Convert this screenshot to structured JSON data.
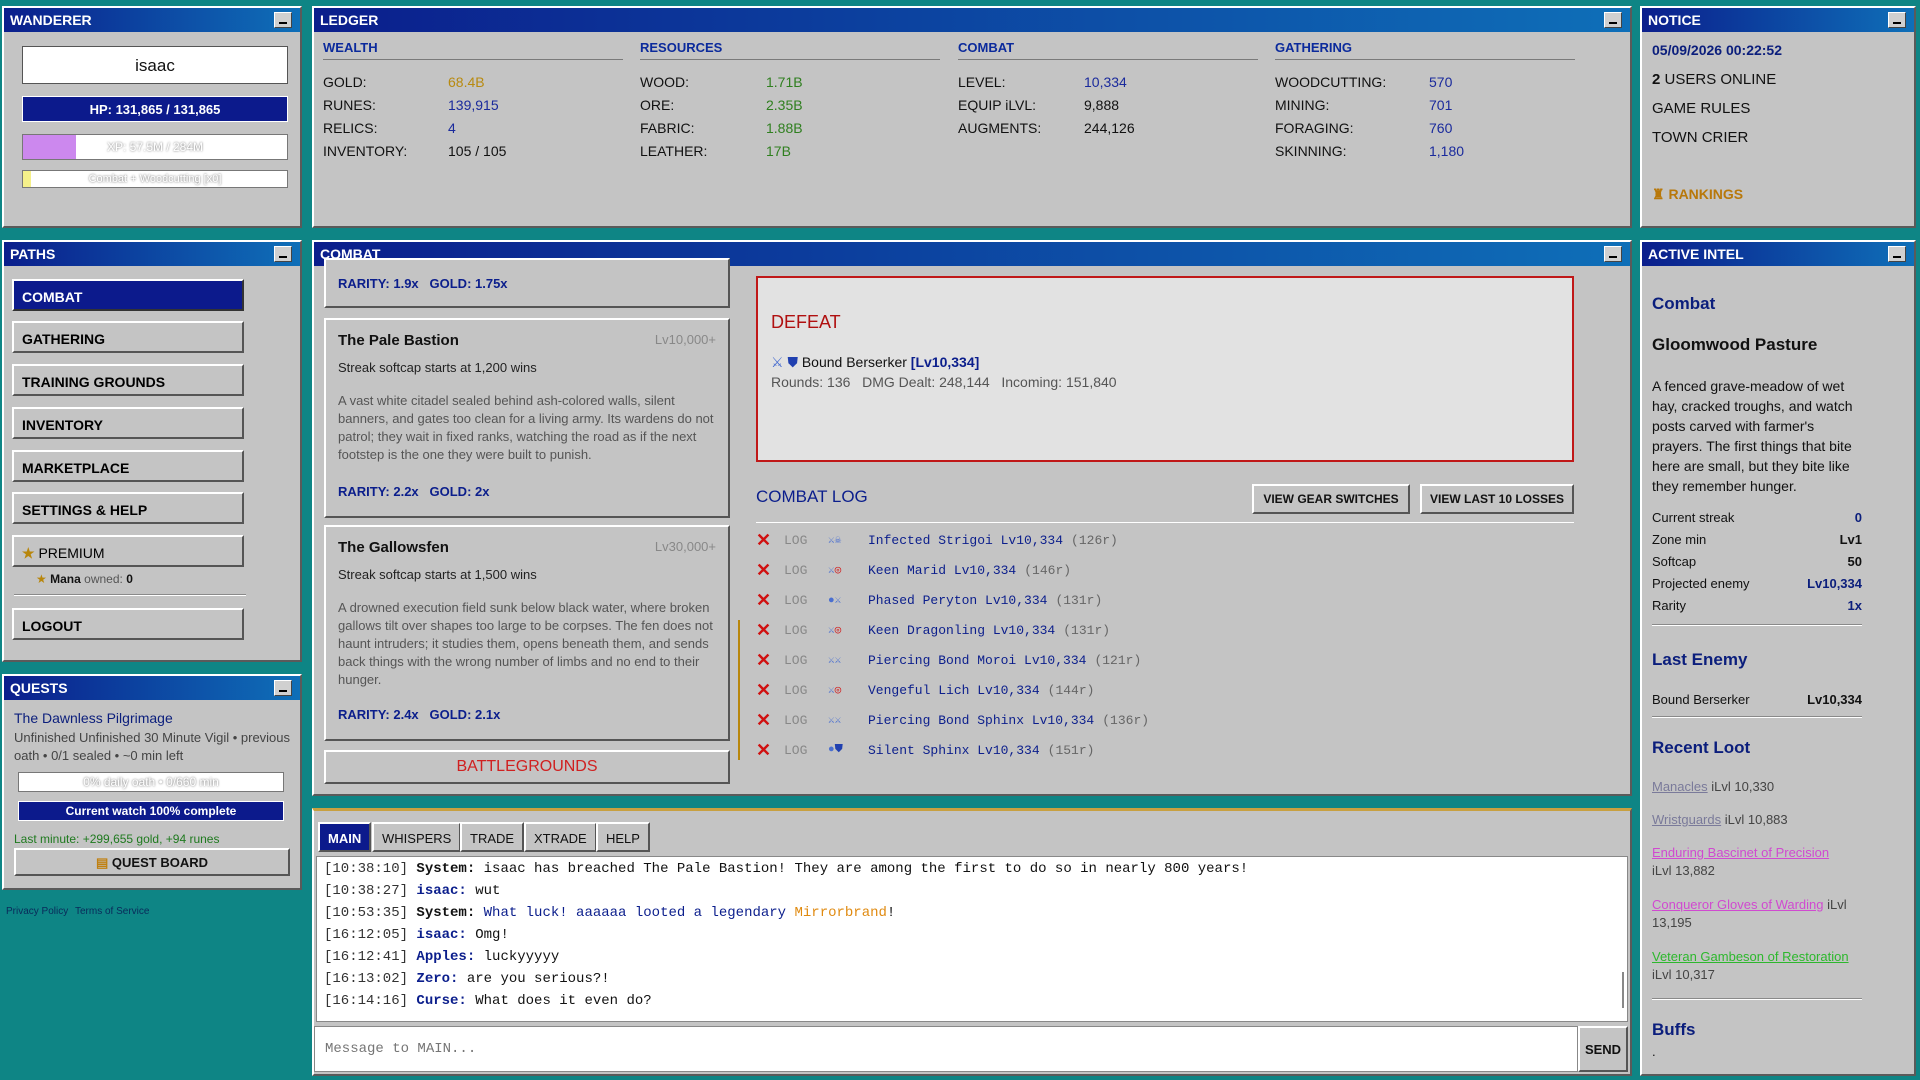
{
  "wanderer": {
    "title": "WANDERER",
    "name": "isaac",
    "hp": "HP: 131,865 / 131,865",
    "xp": "XP: 57.5M / 284M",
    "xp_fraction": 0.2,
    "activity": "Combat + Woodcutting [x0]",
    "activity_fraction": 0.03
  },
  "ledger": {
    "title": "LEDGER",
    "wealth": {
      "head": "WEALTH",
      "rows": [
        {
          "k": "GOLD:",
          "v": "68.4B"
        },
        {
          "k": "RUNES:",
          "v": "139,915"
        },
        {
          "k": "RELICS:",
          "v": "4"
        },
        {
          "k": "INVENTORY:",
          "v": "105 / 105"
        }
      ]
    },
    "resources": {
      "head": "RESOURCES",
      "rows": [
        {
          "k": "WOOD:",
          "v": "1.71B"
        },
        {
          "k": "ORE:",
          "v": "2.35B"
        },
        {
          "k": "FABRIC:",
          "v": "1.88B"
        },
        {
          "k": "LEATHER:",
          "v": "17B"
        }
      ]
    },
    "combat": {
      "head": "COMBAT",
      "rows": [
        {
          "k": "LEVEL:",
          "v": "10,334"
        },
        {
          "k": "EQUIP iLVL:",
          "v": "9,888"
        },
        {
          "k": "AUGMENTS:",
          "v": "244,126"
        }
      ]
    },
    "gathering": {
      "head": "GATHERING",
      "rows": [
        {
          "k": "WOODCUTTING:",
          "v": "570"
        },
        {
          "k": "MINING:",
          "v": "701"
        },
        {
          "k": "FORAGING:",
          "v": "760"
        },
        {
          "k": "SKINNING:",
          "v": "1,180"
        }
      ]
    }
  },
  "notice": {
    "title": "NOTICE",
    "datetime": "05/09/2026 00:22:52",
    "users_count": "2",
    "users_label": "USERS ONLINE",
    "rules": "GAME RULES",
    "crier": "TOWN CRIER",
    "rankings": "RANKINGS"
  },
  "paths": {
    "title": "PATHS",
    "items": [
      "COMBAT",
      "GATHERING",
      "TRAINING GROUNDS",
      "INVENTORY",
      "MARKETPLACE",
      "SETTINGS & HELP"
    ],
    "premium": "PREMIUM",
    "mana_label": "Mana",
    "mana_owned": "owned:",
    "mana_value": "0",
    "logout": "LOGOUT"
  },
  "quests": {
    "title": "QUESTS",
    "name": "The Dawnless Pilgrimage",
    "desc": "Unfinished Unfinished 30 Minute Vigil • previous oath • 0/1 sealed • ~0 min left",
    "daily": "0% daily oath • 0/660 min",
    "watch": "Current watch 100% complete",
    "last_minute": "Last minute: +299,655 gold, +94 runes",
    "board": "QUEST BOARD"
  },
  "footer": {
    "privacy": "Privacy Policy",
    "terms": "Terms of Service"
  },
  "combat": {
    "title": "COMBAT",
    "top_card": {
      "rarity": "RARITY: 1.9x",
      "gold": "GOLD: 1.75x"
    },
    "zones": [
      {
        "name": "The Pale Bastion",
        "level": "Lv10,000+",
        "streak": "Streak softcap starts at 1,200 wins",
        "desc": "A vast white citadel sealed behind ash-colored walls, silent banners, and gates too clean for a living army. Its wardens do not patrol; they wait in fixed ranks, watching the road as if the next footstep is the one they were built to punish.",
        "rarity": "RARITY: 2.2x",
        "gold": "GOLD: 2x"
      },
      {
        "name": "The Gallowsfen",
        "level": "Lv30,000+",
        "streak": "Streak softcap starts at 1,500 wins",
        "desc": "A drowned execution field sunk below black water, where broken gallows tilt over shapes too large to be corpses. The fen does not haunt intruders; it studies them, opens beneath them, and sends back things with the wrong number of limbs and no end to their hunger.",
        "rarity": "RARITY: 2.4x",
        "gold": "GOLD: 2.1x"
      }
    ],
    "battlegrounds": "BATTLEGROUNDS",
    "result": {
      "status": "DEFEAT",
      "enemy": "Bound Berserker",
      "enemy_level": "[Lv10,334]",
      "rounds_label": "Rounds:",
      "rounds": "136",
      "dmg_label": "DMG Dealt:",
      "dmg": "248,144",
      "incoming_label": "Incoming:",
      "incoming": "151,840"
    },
    "log_title": "COMBAT LOG",
    "btn_gear": "VIEW GEAR SWITCHES",
    "btn_losses": "VIEW LAST 10 LOSSES",
    "log": [
      {
        "tag": "LOG",
        "enemy": "Infected Strigoi Lv10,334",
        "rounds": "(126r)"
      },
      {
        "tag": "LOG",
        "enemy": "Keen Marid Lv10,334",
        "rounds": "(146r)"
      },
      {
        "tag": "LOG",
        "enemy": "Phased Peryton Lv10,334",
        "rounds": "(131r)"
      },
      {
        "tag": "LOG",
        "enemy": "Keen Dragonling Lv10,334",
        "rounds": "(131r)"
      },
      {
        "tag": "LOG",
        "enemy": "Piercing Bond Moroi Lv10,334",
        "rounds": "(121r)"
      },
      {
        "tag": "LOG",
        "enemy": "Vengeful Lich Lv10,334",
        "rounds": "(144r)"
      },
      {
        "tag": "LOG",
        "enemy": "Piercing Bond Sphinx Lv10,334",
        "rounds": "(136r)"
      },
      {
        "tag": "LOG",
        "enemy": "Silent Sphinx Lv10,334",
        "rounds": "(151r)"
      }
    ]
  },
  "intel": {
    "title": "ACTIVE INTEL",
    "section": "Combat",
    "zone": "Gloomwood Pasture",
    "desc": "A fenced grave-meadow of wet hay, cracked troughs, and watch posts carved with farmer's prayers. The first things that bite here are small, but they bite like they remember hunger.",
    "stats": [
      {
        "k": "Current streak",
        "v": "0"
      },
      {
        "k": "Zone min",
        "v": "Lv1"
      },
      {
        "k": "Softcap",
        "v": "50"
      },
      {
        "k": "Projected enemy",
        "v": "Lv10,334"
      },
      {
        "k": "Rarity",
        "v": "1x"
      }
    ],
    "last_enemy_head": "Last Enemy",
    "last_enemy": "Bound Berserker",
    "last_enemy_level": "Lv10,334",
    "loot_head": "Recent Loot",
    "loot": [
      {
        "name": "Manacles",
        "ilvl": "iLvl 10,330",
        "color": "#7a7a9a"
      },
      {
        "name": "Wristguards",
        "ilvl": "iLvl 10,883",
        "color": "#7a7a9a"
      },
      {
        "name": "Enduring Bascinet of Precision",
        "ilvl": "iLvl 13,882",
        "color": "#d04ad0"
      },
      {
        "name": "Conqueror Gloves of Warding",
        "ilvl": "iLvl 13,195",
        "color": "#d04ad0"
      },
      {
        "name": "Veteran Gambeson of Restoration",
        "ilvl": "iLvl 10,317",
        "color": "#2db82d"
      }
    ],
    "buffs_head": "Buffs",
    "buffs": "."
  },
  "chat": {
    "tabs": [
      "MAIN",
      "WHISPERS",
      "TRADE",
      "XTRADE",
      "HELP"
    ],
    "lines": [
      {
        "ts": "[10:38:10]",
        "nm": "System:",
        "msg": " isaac has breached The Pale Bastion! They are among the first to do so in nearly 800 years!"
      },
      {
        "ts": "[10:38:27]",
        "nm": "isaac:",
        "msg": " wut"
      },
      {
        "ts": "[10:53:35]",
        "nm": "System:",
        "msg": " What luck! aaaaaa looted a legendary ",
        "item": "Mirrorbrand",
        "end": "!"
      },
      {
        "ts": "[16:12:05]",
        "nm": "isaac:",
        "msg": " Omg!"
      },
      {
        "ts": "[16:12:41]",
        "nm": "Apples:",
        "msg": " luckyyyyy"
      },
      {
        "ts": "[16:13:02]",
        "nm": "Zero:",
        "msg": " are you serious?!"
      },
      {
        "ts": "[16:14:16]",
        "nm": "Curse:",
        "msg": " What does it even do?"
      }
    ],
    "placeholder": "Message to MAIN...",
    "send": "SEND"
  }
}
